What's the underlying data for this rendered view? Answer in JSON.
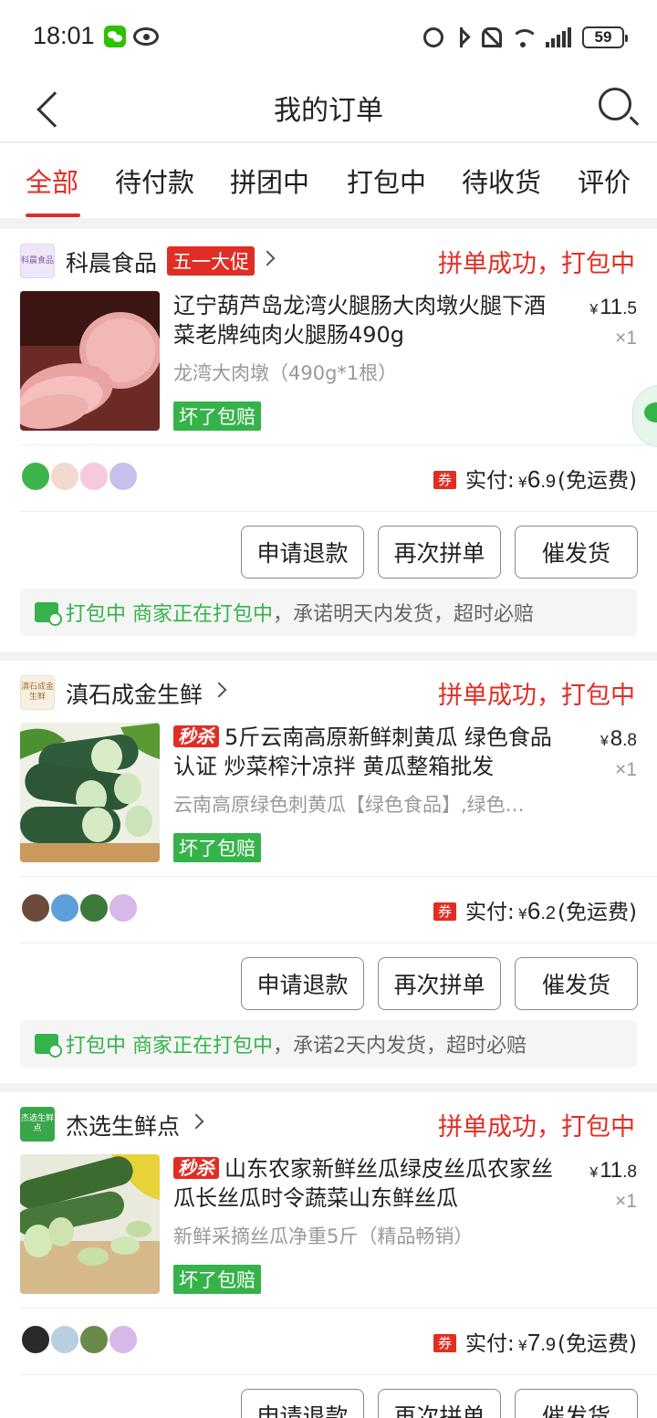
{
  "status_bar": {
    "time": "18:01",
    "battery": "59"
  },
  "nav": {
    "title": "我的订单"
  },
  "tabs": [
    {
      "label": "全部",
      "active": true
    },
    {
      "label": "待付款"
    },
    {
      "label": "拼团中"
    },
    {
      "label": "打包中"
    },
    {
      "label": "待收货"
    },
    {
      "label": "评价"
    }
  ],
  "orders": [
    {
      "shop": {
        "name": "科晨食品",
        "logo_text": "科晨食品",
        "promo": "五一大促"
      },
      "status": "拼单成功，打包中",
      "product": {
        "title": "辽宁葫芦岛龙湾火腿肠大肉墩火腿下酒菜老牌纯肉火腿肠490g",
        "flash_tag": "",
        "spec": "龙湾大肉墩（490g*1根）",
        "guarantee": "坏了包赔",
        "price_yen": "¥",
        "price_int": "11",
        "price_dec": ".5",
        "qty": "×1"
      },
      "payment": {
        "coupon": "券",
        "label": "实付:",
        "yen": "¥",
        "int": "6",
        "dec": ".9",
        "shipping": "(免运费)"
      },
      "buttons": {
        "refund": "申请退款",
        "regroup": "再次拼单",
        "urge": "催发货"
      },
      "notice": {
        "status": "打包中 商家正在打包中",
        "detail": "，承诺明天内发货，超时必赔"
      }
    },
    {
      "shop": {
        "name": "滇石成金生鲜",
        "logo_text": "滇石成金生鲜",
        "promo": ""
      },
      "status": "拼单成功，打包中",
      "product": {
        "title": "5斤云南高原新鲜刺黄瓜 绿色食品认证 炒菜榨汁凉拌 黄瓜整箱批发",
        "flash_tag": "秒杀",
        "spec": "云南高原绿色刺黄瓜【绿色食品】,绿色…",
        "guarantee": "坏了包赔",
        "price_yen": "¥",
        "price_int": "8",
        "price_dec": ".8",
        "qty": "×1"
      },
      "payment": {
        "coupon": "券",
        "label": "实付:",
        "yen": "¥",
        "int": "6",
        "dec": ".2",
        "shipping": "(免运费)"
      },
      "buttons": {
        "refund": "申请退款",
        "regroup": "再次拼单",
        "urge": "催发货"
      },
      "notice": {
        "status": "打包中 商家正在打包中",
        "detail": "，承诺2天内发货，超时必赔"
      }
    },
    {
      "shop": {
        "name": "杰选生鲜点",
        "logo_text": "杰选生鲜点",
        "promo": ""
      },
      "status": "拼单成功，打包中",
      "product": {
        "title": "山东农家新鲜丝瓜绿皮丝瓜农家丝瓜长丝瓜时令蔬菜山东鲜丝瓜",
        "flash_tag": "秒杀",
        "spec": "新鲜采摘丝瓜净重5斤（精品畅销）",
        "guarantee": "坏了包赔",
        "price_yen": "¥",
        "price_int": "11",
        "price_dec": ".8",
        "qty": "×1"
      },
      "payment": {
        "coupon": "券",
        "label": "实付:",
        "yen": "¥",
        "int": "7",
        "dec": ".9",
        "shipping": "(免运费)"
      },
      "buttons": {
        "refund": "申请退款",
        "regroup": "再次拼单",
        "urge": "催发货"
      }
    }
  ]
}
